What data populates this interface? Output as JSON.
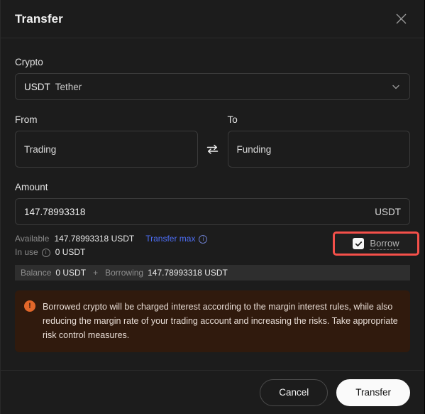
{
  "modal": {
    "title": "Transfer",
    "close_icon": "close-icon"
  },
  "crypto": {
    "label": "Crypto",
    "symbol": "USDT",
    "name": "Tether",
    "chevron_icon": "chevron-down-icon"
  },
  "from": {
    "label": "From",
    "value": "Trading"
  },
  "swap": {
    "icon": "swap-arrows-icon"
  },
  "to": {
    "label": "To",
    "value": "Funding"
  },
  "amount": {
    "label": "Amount",
    "value": "147.78993318",
    "placeholder": "0",
    "unit": "USDT"
  },
  "meta": {
    "available_label": "Available",
    "available_value": "147.78993318 USDT",
    "transfer_max_label": "Transfer max",
    "transfer_max_info_icon": "info-icon",
    "in_use_label": "In use",
    "in_use_info_icon": "info-icon",
    "in_use_value": "0 USDT"
  },
  "borrow": {
    "label": "Borrow",
    "checked": true,
    "check_icon": "checkmark-icon",
    "highlight_color": "#f4504a"
  },
  "balance_strip": {
    "balance_label": "Balance",
    "balance_value": "0 USDT",
    "plus": "+",
    "borrowing_label": "Borrowing",
    "borrowing_value": "147.78993318 USDT"
  },
  "warning": {
    "icon": "warning-exclamation-icon",
    "icon_color": "#e2672a",
    "text": "Borrowed crypto will be charged interest according to the margin interest rules, while also reducing the margin rate of your trading account and increasing the risks. Take appropriate risk control measures."
  },
  "footer": {
    "cancel_label": "Cancel",
    "transfer_label": "Transfer"
  }
}
